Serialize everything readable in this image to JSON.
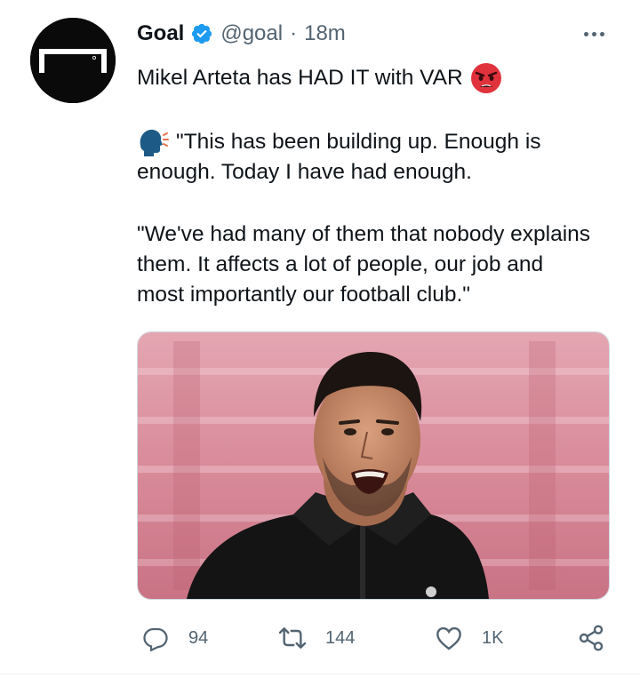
{
  "tweet": {
    "author_name": "Goal",
    "handle": "@goal",
    "separator": "·",
    "time": "18m",
    "text_line1": "Mikel Arteta has HAD IT with VAR",
    "quote1_line1": "\"This has been building up. Enough is",
    "quote1_line2": "enough. Today I have had enough.",
    "quote2_line1": "\"We've had many of them that nobody explains",
    "quote2_line2": "them. It affects a lot of people, our job and",
    "quote2_line3": "most importantly our football club.\"",
    "emojis": [
      "angry-face-emoji",
      "speaking-head-emoji"
    ],
    "media": {
      "type": "photo",
      "description_icon": "photo-of-manager"
    }
  },
  "actions": {
    "reply_count": "94",
    "retweet_count": "144",
    "like_count": "1K"
  },
  "colors": {
    "verified": "#1d9bf0",
    "secondary_text": "#536471",
    "primary_text": "#0f1419",
    "background": "#ffffff"
  }
}
